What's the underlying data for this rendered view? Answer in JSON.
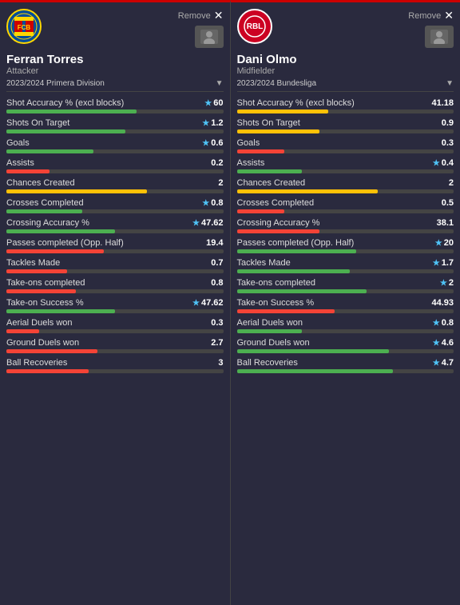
{
  "players": [
    {
      "id": "ferran",
      "name": "Ferran Torres",
      "role": "Attacker",
      "season": "2023/2024 Primera Division",
      "clubLogo": "barca",
      "side": "left",
      "stats": [
        {
          "label": "Shot Accuracy % (excl blocks)",
          "value": "60",
          "star": true,
          "barColor": "green",
          "barPct": 60
        },
        {
          "label": "Shots On Target",
          "value": "1.2",
          "star": true,
          "barColor": "green",
          "barPct": 55
        },
        {
          "label": "Goals",
          "value": "0.6",
          "star": true,
          "barColor": "green",
          "barPct": 40
        },
        {
          "label": "Assists",
          "value": "0.2",
          "star": false,
          "barColor": "red",
          "barPct": 20
        },
        {
          "label": "Chances Created",
          "value": "2",
          "star": false,
          "barColor": "yellow",
          "barPct": 65
        },
        {
          "label": "Crosses Completed",
          "value": "0.8",
          "star": true,
          "barColor": "green",
          "barPct": 35
        },
        {
          "label": "Crossing Accuracy %",
          "value": "47.62",
          "star": true,
          "barColor": "green",
          "barPct": 50
        },
        {
          "label": "Passes completed (Opp. Half)",
          "value": "19.4",
          "star": false,
          "barColor": "red",
          "barPct": 45
        },
        {
          "label": "Tackles Made",
          "value": "0.7",
          "star": false,
          "barColor": "red",
          "barPct": 28
        },
        {
          "label": "Take-ons completed",
          "value": "0.8",
          "star": false,
          "barColor": "red",
          "barPct": 32
        },
        {
          "label": "Take-on Success %",
          "value": "47.62",
          "star": true,
          "barColor": "green",
          "barPct": 50
        },
        {
          "label": "Aerial Duels won",
          "value": "0.3",
          "star": false,
          "barColor": "red",
          "barPct": 15
        },
        {
          "label": "Ground Duels won",
          "value": "2.7",
          "star": false,
          "barColor": "red",
          "barPct": 42
        },
        {
          "label": "Ball Recoveries",
          "value": "3",
          "star": false,
          "barColor": "red",
          "barPct": 38
        }
      ]
    },
    {
      "id": "dani",
      "name": "Dani Olmo",
      "role": "Midfielder",
      "season": "2023/2024 Bundesliga",
      "clubLogo": "rb",
      "side": "right",
      "stats": [
        {
          "label": "Shot Accuracy % (excl blocks)",
          "value": "41.18",
          "star": false,
          "barColor": "yellow",
          "barPct": 42
        },
        {
          "label": "Shots On Target",
          "value": "0.9",
          "star": false,
          "barColor": "yellow",
          "barPct": 38
        },
        {
          "label": "Goals",
          "value": "0.3",
          "star": false,
          "barColor": "red",
          "barPct": 22
        },
        {
          "label": "Assists",
          "value": "0.4",
          "star": true,
          "barColor": "green",
          "barPct": 30
        },
        {
          "label": "Chances Created",
          "value": "2",
          "star": false,
          "barColor": "yellow",
          "barPct": 65
        },
        {
          "label": "Crosses Completed",
          "value": "0.5",
          "star": false,
          "barColor": "red",
          "barPct": 22
        },
        {
          "label": "Crossing Accuracy %",
          "value": "38.1",
          "star": false,
          "barColor": "red",
          "barPct": 38
        },
        {
          "label": "Passes completed (Opp. Half)",
          "value": "20",
          "star": true,
          "barColor": "green",
          "barPct": 55
        },
        {
          "label": "Tackles Made",
          "value": "1.7",
          "star": true,
          "barColor": "green",
          "barPct": 52
        },
        {
          "label": "Take-ons completed",
          "value": "2",
          "star": true,
          "barColor": "green",
          "barPct": 60
        },
        {
          "label": "Take-on Success %",
          "value": "44.93",
          "star": false,
          "barColor": "red",
          "barPct": 45
        },
        {
          "label": "Aerial Duels won",
          "value": "0.8",
          "star": true,
          "barColor": "green",
          "barPct": 30
        },
        {
          "label": "Ground Duels won",
          "value": "4.6",
          "star": true,
          "barColor": "green",
          "barPct": 70
        },
        {
          "label": "Ball Recoveries",
          "value": "4.7",
          "star": true,
          "barColor": "green",
          "barPct": 72
        }
      ]
    }
  ],
  "labels": {
    "remove": "Remove"
  }
}
